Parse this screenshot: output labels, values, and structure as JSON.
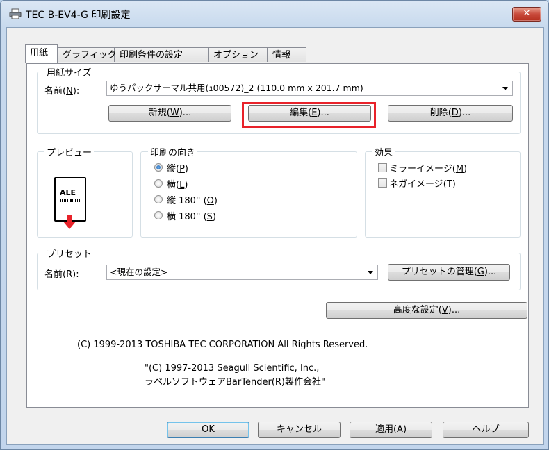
{
  "window": {
    "title": "TEC B-EV4-G 印刷設定",
    "close_glyph": "✕"
  },
  "tabs": [
    {
      "label": "用紙",
      "active": true
    },
    {
      "label": "グラフィック"
    },
    {
      "label": "印刷条件の設定"
    },
    {
      "label": "オプション"
    },
    {
      "label": "情報"
    }
  ],
  "paper_size": {
    "group_label": "用紙サイズ",
    "name_label": "名前(",
    "name_key": "N",
    "name_label_end": "):",
    "selected": "ゆうパックサーマル共用(ｭ00572)_2 (110.0 mm x 201.7 mm)",
    "new_button": {
      "text": "新規(",
      "key": "W",
      "end": ")..."
    },
    "edit_button": {
      "text": "編集(",
      "key": "E",
      "end": ")..."
    },
    "delete_button": {
      "text": "削除(",
      "key": "D",
      "end": ")..."
    }
  },
  "preview": {
    "group_label": "プレビュー",
    "doc_text": "ALE"
  },
  "orientation": {
    "group_label": "印刷の向き",
    "options": [
      {
        "label": "縦(",
        "key": "P",
        "end": ")",
        "checked": true
      },
      {
        "label": "横(",
        "key": "L",
        "end": ")",
        "checked": false
      },
      {
        "label": "縦 180°  (",
        "key": "O",
        "end": ")",
        "checked": false
      },
      {
        "label": "横 180°  (",
        "key": "S",
        "end": ")",
        "checked": false
      }
    ]
  },
  "effects": {
    "group_label": "効果",
    "mirror": {
      "label": "ミラーイメージ(",
      "key": "M",
      "end": ")"
    },
    "negative": {
      "label": "ネガイメージ(",
      "key": "T",
      "end": ")"
    }
  },
  "preset": {
    "group_label": "プリセット",
    "name_label": "名前(",
    "name_key": "R",
    "name_label_end": "):",
    "selected": "<現在の設定>",
    "manage_button": {
      "text": "プリセットの管理(",
      "key": "G",
      "end": ")..."
    }
  },
  "advanced_button": {
    "text": "高度な設定(",
    "key": "V",
    "end": ")..."
  },
  "copyright": {
    "line1": "(C) 1999-2013 TOSHIBA TEC CORPORATION All Rights Reserved.",
    "line2": "\"(C) 1997-2013 Seagull Scientific, Inc.,",
    "line3": "ラベルソフトウェアBarTender(R)製作会社\""
  },
  "footer": {
    "ok": "OK",
    "cancel": "キャンセル",
    "apply": {
      "text": "適用(",
      "key": "A",
      "end": ")"
    },
    "help": "ヘルプ"
  },
  "colors": {
    "highlight": "#e8222a",
    "close_button": "#c8493a"
  }
}
